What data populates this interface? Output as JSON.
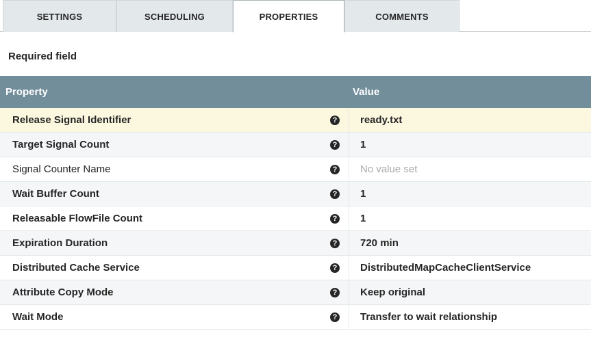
{
  "tabs": [
    {
      "label": "SETTINGS"
    },
    {
      "label": "SCHEDULING"
    },
    {
      "label": "PROPERTIES"
    },
    {
      "label": "COMMENTS"
    }
  ],
  "active_tab": "PROPERTIES",
  "required_field_label": "Required field",
  "table": {
    "header_property": "Property",
    "header_value": "Value",
    "rows": [
      {
        "name": "Release Signal Identifier",
        "value": "ready.txt"
      },
      {
        "name": "Target Signal Count",
        "value": "1"
      },
      {
        "name": "Signal Counter Name",
        "value": "No value set"
      },
      {
        "name": "Wait Buffer Count",
        "value": "1"
      },
      {
        "name": "Releasable FlowFile Count",
        "value": "1"
      },
      {
        "name": "Expiration Duration",
        "value": "720 min"
      },
      {
        "name": "Distributed Cache Service",
        "value": "DistributedMapCacheClientService"
      },
      {
        "name": "Attribute Copy Mode",
        "value": "Keep original"
      },
      {
        "name": "Wait Mode",
        "value": "Transfer to wait relationship"
      }
    ]
  },
  "colors": {
    "header_bg": "#728e9b",
    "selected_row_bg": "#fcf7df",
    "tab_bg": "#e3e8eb"
  },
  "icons": {
    "help": "question-circle-icon"
  }
}
